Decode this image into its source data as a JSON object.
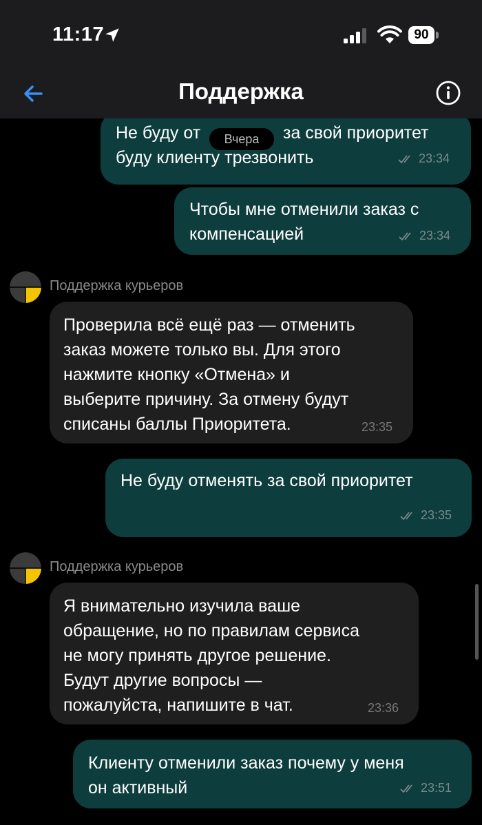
{
  "status": {
    "time": "11:17",
    "battery": "90"
  },
  "nav": {
    "title": "Поддержка"
  },
  "chat": {
    "date_label": "Вчера",
    "messages": [
      {
        "side": "out",
        "lines": [
          "Не буду от",
          "буду клиенту трезвонить"
        ],
        "line1_tail": "за свой приоритет",
        "time": "23:34",
        "read": true
      },
      {
        "side": "out",
        "lines": [
          "Чтобы мне отменили заказ с",
          "компенсацией"
        ],
        "time": "23:34",
        "read": true
      },
      {
        "side": "in",
        "sender": "Поддержка курьеров",
        "lines": [
          "Проверила всё ещё раз — отменить",
          "заказ можете только вы. Для этого",
          "нажмите кнопку «Отмена» и",
          "выберите причину. За отмену будут",
          "списаны баллы Приоритета."
        ],
        "time": "23:35"
      },
      {
        "side": "out",
        "lines": [
          "Не буду отменять за свой приоритет"
        ],
        "time": "23:35",
        "read": true
      },
      {
        "side": "in",
        "sender": "Поддержка курьеров",
        "lines": [
          "Я внимательно изучила ваше",
          "обращение, но по правилам сервиса",
          "не могу принять другое решение.",
          "Будут другие вопросы —",
          "пожалуйста, напишите в чат."
        ],
        "time": "23:36"
      },
      {
        "side": "out",
        "lines": [
          "Клиенту отменили заказ почему у меня",
          "он активный"
        ],
        "time": "23:51",
        "read": true
      }
    ]
  },
  "colors": {
    "accent": "#3a8ef6",
    "outgoing_bubble": "#0d3d3c",
    "incoming_bubble": "#1f1f1f",
    "avatar_yellow": "#f5c400"
  }
}
